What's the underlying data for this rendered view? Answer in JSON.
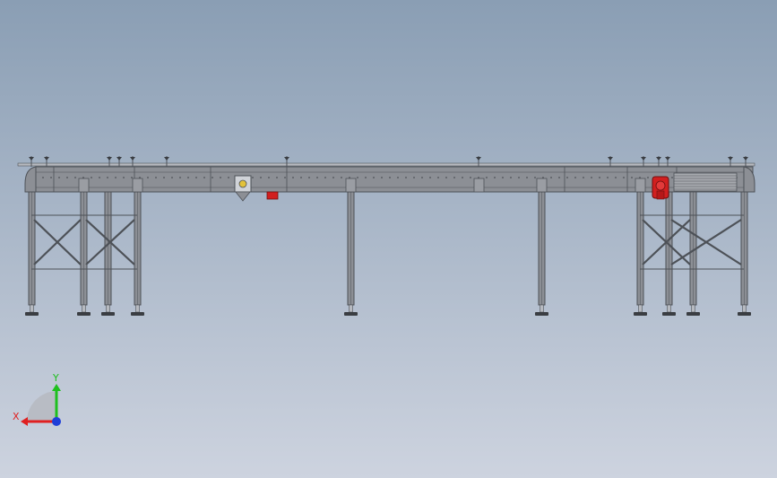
{
  "viewport": {
    "background_top": "#8a9eb4",
    "background_bottom": "#cdd3df"
  },
  "colors": {
    "frame": "#8c8f95",
    "frame_dark": "#4d5157",
    "frame_light": "#b7bac0",
    "motor_red": "#d11f1f",
    "foot": "#3a3d42",
    "axis_x": "#e02020",
    "axis_y": "#1ec01e",
    "axis_z": "#1f3fd8"
  },
  "triad": {
    "x_label": "X",
    "y_label": "Y",
    "x_icon": "x-axis-arrow",
    "y_icon": "y-axis-arrow",
    "z_icon": "z-axis-dot"
  }
}
